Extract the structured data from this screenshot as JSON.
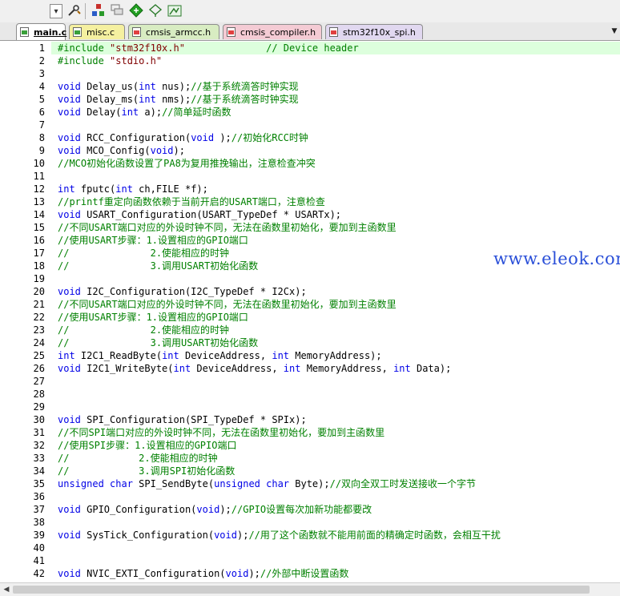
{
  "toolbar": {
    "icons": [
      "dropdown-arrow-icon",
      "wrench-build-icon",
      "manage-components-icon",
      "layers-icon",
      "green-diamond-icon",
      "translate-icon",
      "batch-icon"
    ]
  },
  "tabs": [
    {
      "label": "main.c",
      "active": true,
      "type": "c"
    },
    {
      "label": "misc.c",
      "active": false,
      "type": "c"
    },
    {
      "label": "cmsis_armcc.h",
      "active": false,
      "type": "h"
    },
    {
      "label": "cmsis_compiler.h",
      "active": false,
      "type": "h"
    },
    {
      "label": "stm32f10x_spi.h",
      "active": false,
      "type": "h"
    }
  ],
  "colors": {
    "tab_yellow": "#f5f0a0",
    "tab_green": "#d8ecc2",
    "tab_pink": "#f4cbd4",
    "tab_lavender": "#e1d8f0",
    "keyword": "#0000e6",
    "comment": "#008000",
    "string": "#800000",
    "current_line": "#ddffdd",
    "watermark": "#2a4fd8"
  },
  "lines": [
    {
      "n": "1",
      "tokens": [
        [
          "cm",
          "#include "
        ],
        [
          "st",
          "\"stm32f10x.h\""
        ],
        [
          "",
          "              "
        ],
        [
          "cm",
          "// Device header"
        ]
      ]
    },
    {
      "n": "2",
      "tokens": [
        [
          "cm",
          "#include "
        ],
        [
          "st",
          "\"stdio.h\""
        ]
      ]
    },
    {
      "n": "3",
      "tokens": []
    },
    {
      "n": "4",
      "tokens": [
        [
          "kw",
          "void"
        ],
        [
          "",
          " Delay_us("
        ],
        [
          "kw",
          "int"
        ],
        [
          "",
          " nus);"
        ],
        [
          "cm",
          "//基于系统滴答时钟实现"
        ]
      ]
    },
    {
      "n": "5",
      "tokens": [
        [
          "kw",
          "void"
        ],
        [
          "",
          " Delay_ms("
        ],
        [
          "kw",
          "int"
        ],
        [
          "",
          " nms);"
        ],
        [
          "cm",
          "//基于系统滴答时钟实现"
        ]
      ]
    },
    {
      "n": "6",
      "tokens": [
        [
          "kw",
          "void"
        ],
        [
          "",
          " Delay("
        ],
        [
          "kw",
          "int"
        ],
        [
          "",
          " a);"
        ],
        [
          "cm",
          "//简单延时函数"
        ]
      ]
    },
    {
      "n": "7",
      "tokens": []
    },
    {
      "n": "8",
      "tokens": [
        [
          "kw",
          "void"
        ],
        [
          "",
          " RCC_Configuration("
        ],
        [
          "kw",
          "void"
        ],
        [
          "",
          " );"
        ],
        [
          "cm",
          "//初始化RCC时钟"
        ]
      ]
    },
    {
      "n": "9",
      "tokens": [
        [
          "kw",
          "void"
        ],
        [
          "",
          " MCO_Config("
        ],
        [
          "kw",
          "void"
        ],
        [
          "",
          ");"
        ]
      ]
    },
    {
      "n": "10",
      "tokens": [
        [
          "cm",
          "//MCO初始化函数设置了PA8为复用推挽输出，注意检查冲突"
        ]
      ]
    },
    {
      "n": "11",
      "tokens": []
    },
    {
      "n": "12",
      "tokens": [
        [
          "kw",
          "int"
        ],
        [
          "",
          " fputc("
        ],
        [
          "kw",
          "int"
        ],
        [
          "",
          " ch,FILE *f);"
        ]
      ]
    },
    {
      "n": "13",
      "tokens": [
        [
          "cm",
          "//printf重定向函数依赖于当前开启的USART端口，注意检查"
        ]
      ]
    },
    {
      "n": "14",
      "tokens": [
        [
          "kw",
          "void"
        ],
        [
          "",
          " USART_Configuration(USART_TypeDef * USARTx);"
        ]
      ]
    },
    {
      "n": "15",
      "tokens": [
        [
          "cm",
          "//不同USART端口对应的外设时钟不同，无法在函数里初始化，要加到主函数里"
        ]
      ]
    },
    {
      "n": "16",
      "tokens": [
        [
          "cm",
          "//使用USART步骤：1.设置相应的GPIO端口"
        ]
      ]
    },
    {
      "n": "17",
      "tokens": [
        [
          "cm",
          "//              2.使能相应的时钟"
        ]
      ]
    },
    {
      "n": "18",
      "tokens": [
        [
          "cm",
          "//              3.调用USART初始化函数"
        ]
      ]
    },
    {
      "n": "19",
      "tokens": []
    },
    {
      "n": "20",
      "tokens": [
        [
          "kw",
          "void"
        ],
        [
          "",
          " I2C_Configuration(I2C_TypeDef * I2Cx);"
        ]
      ]
    },
    {
      "n": "21",
      "tokens": [
        [
          "cm",
          "//不同USART端口对应的外设时钟不同，无法在函数里初始化，要加到主函数里"
        ]
      ]
    },
    {
      "n": "22",
      "tokens": [
        [
          "cm",
          "//使用USART步骤：1.设置相应的GPIO端口"
        ]
      ]
    },
    {
      "n": "23",
      "tokens": [
        [
          "cm",
          "//              2.使能相应的时钟"
        ]
      ]
    },
    {
      "n": "24",
      "tokens": [
        [
          "cm",
          "//              3.调用USART初始化函数"
        ]
      ]
    },
    {
      "n": "25",
      "tokens": [
        [
          "kw",
          "int"
        ],
        [
          "",
          " I2C1_ReadByte("
        ],
        [
          "kw",
          "int"
        ],
        [
          "",
          " DeviceAddress, "
        ],
        [
          "kw",
          "int"
        ],
        [
          "",
          " MemoryAddress);"
        ]
      ]
    },
    {
      "n": "26",
      "tokens": [
        [
          "kw",
          "void"
        ],
        [
          "",
          " I2C1_WriteByte("
        ],
        [
          "kw",
          "int"
        ],
        [
          "",
          " DeviceAddress, "
        ],
        [
          "kw",
          "int"
        ],
        [
          "",
          " MemoryAddress, "
        ],
        [
          "kw",
          "int"
        ],
        [
          "",
          " Data);"
        ]
      ]
    },
    {
      "n": "27",
      "tokens": []
    },
    {
      "n": "28",
      "tokens": []
    },
    {
      "n": "29",
      "tokens": []
    },
    {
      "n": "30",
      "tokens": [
        [
          "kw",
          "void"
        ],
        [
          "",
          " SPI_Configuration(SPI_TypeDef * SPIx);"
        ]
      ]
    },
    {
      "n": "31",
      "tokens": [
        [
          "cm",
          "//不同SPI端口对应的外设时钟不同，无法在函数里初始化，要加到主函数里"
        ]
      ]
    },
    {
      "n": "32",
      "tokens": [
        [
          "cm",
          "//使用SPI步骤：1.设置相应的GPIO端口"
        ]
      ]
    },
    {
      "n": "33",
      "tokens": [
        [
          "cm",
          "//            2.使能相应的时钟"
        ]
      ]
    },
    {
      "n": "34",
      "tokens": [
        [
          "cm",
          "//            3.调用SPI初始化函数"
        ]
      ]
    },
    {
      "n": "35",
      "tokens": [
        [
          "kw",
          "unsigned"
        ],
        [
          "",
          " "
        ],
        [
          "kw",
          "char"
        ],
        [
          "",
          " SPI_SendByte("
        ],
        [
          "kw",
          "unsigned"
        ],
        [
          "",
          " "
        ],
        [
          "kw",
          "char"
        ],
        [
          "",
          " Byte);"
        ],
        [
          "cm",
          "//双向全双工时发送接收一个字节"
        ]
      ]
    },
    {
      "n": "36",
      "tokens": []
    },
    {
      "n": "37",
      "tokens": [
        [
          "kw",
          "void"
        ],
        [
          "",
          " GPIO_Configuration("
        ],
        [
          "kw",
          "void"
        ],
        [
          "",
          ");"
        ],
        [
          "cm",
          "//GPIO设置每次加新功能都要改"
        ]
      ]
    },
    {
      "n": "38",
      "tokens": []
    },
    {
      "n": "39",
      "tokens": [
        [
          "kw",
          "void"
        ],
        [
          "",
          " SysTick_Configuration("
        ],
        [
          "kw",
          "void"
        ],
        [
          "",
          ");"
        ],
        [
          "cm",
          "//用了这个函数就不能用前面的精确定时函数，会相互干扰"
        ]
      ]
    },
    {
      "n": "40",
      "tokens": []
    },
    {
      "n": "41",
      "tokens": []
    },
    {
      "n": "42",
      "tokens": [
        [
          "kw",
          "void"
        ],
        [
          "",
          " NVIC_EXTI_Configuration("
        ],
        [
          "kw",
          "void"
        ],
        [
          "",
          ");"
        ],
        [
          "cm",
          "//外部中断设置函数"
        ]
      ]
    }
  ],
  "watermark": "www.eleok.com",
  "scroll": {
    "left_arrow": "◀"
  }
}
